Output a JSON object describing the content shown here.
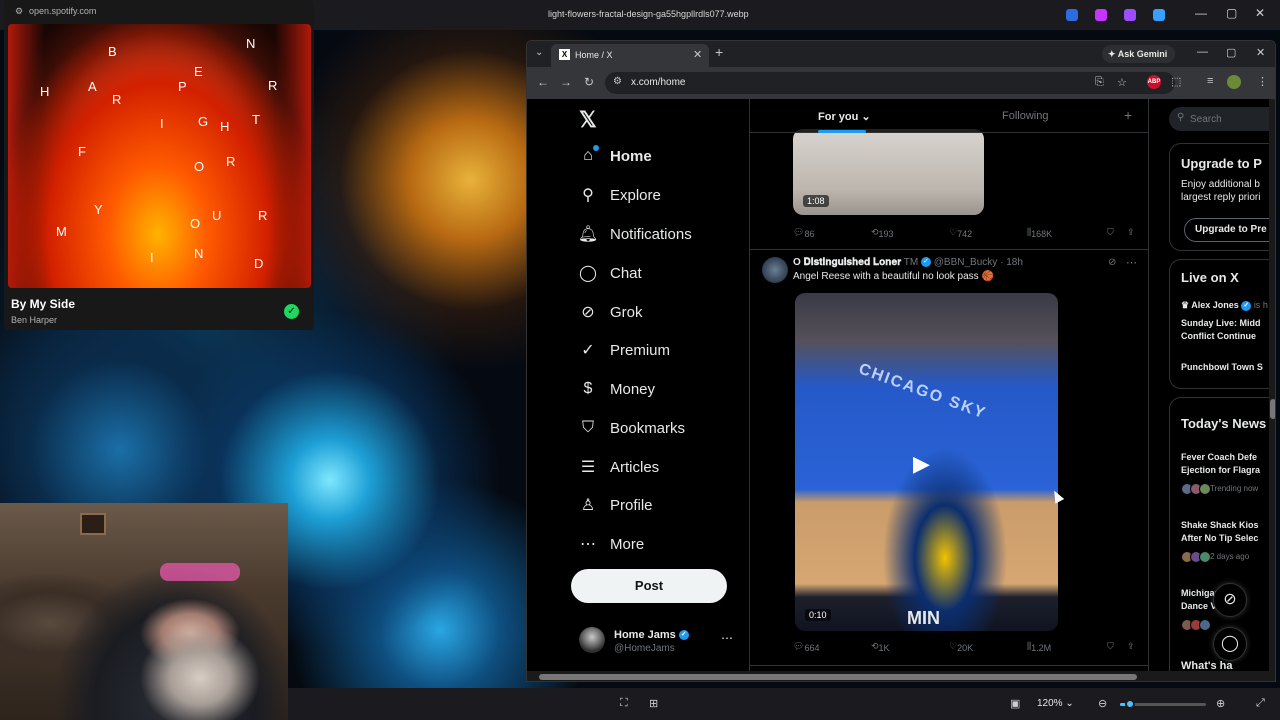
{
  "window": {
    "title": "light-flowers-fractal-design-ga55hgpllrdls077.webp",
    "minimize_icon": "minimize-icon",
    "maximize_icon": "maximize-icon",
    "close_icon": "close-icon"
  },
  "spotify": {
    "url": "open.spotify.com",
    "cover_letters": [
      "B",
      "N",
      "E",
      "H",
      "A",
      "R",
      "P",
      "R",
      "I",
      "G",
      "H",
      "T",
      "F",
      "O",
      "R",
      "Y",
      "O",
      "U",
      "R",
      "M",
      "I",
      "N",
      "D"
    ],
    "track_title": "By My Side",
    "artist": "Ben Harper",
    "saved_icon": "check-icon"
  },
  "browser": {
    "tab_title": "Home / X",
    "ask_gemini": "Ask Gemini",
    "address": "x.com/home"
  },
  "x": {
    "logo": "𝕏",
    "nav": [
      {
        "label": "Home",
        "icon": "home-icon",
        "glyph": "⌂"
      },
      {
        "label": "Explore",
        "icon": "search-icon",
        "glyph": "⚲"
      },
      {
        "label": "Notifications",
        "icon": "bell-icon",
        "glyph": "♫"
      },
      {
        "label": "Chat",
        "icon": "chat-icon",
        "glyph": "◯"
      },
      {
        "label": "Grok",
        "icon": "grok-icon",
        "glyph": "⊘"
      },
      {
        "label": "Premium",
        "icon": "premium-icon",
        "glyph": "✓"
      },
      {
        "label": "Money",
        "icon": "money-icon",
        "glyph": "$"
      },
      {
        "label": "Bookmarks",
        "icon": "bookmark-icon",
        "glyph": "⛉"
      },
      {
        "label": "Articles",
        "icon": "articles-icon",
        "glyph": "☰"
      },
      {
        "label": "Profile",
        "icon": "profile-icon",
        "glyph": "♙"
      },
      {
        "label": "More",
        "icon": "more-icon",
        "glyph": "⋯"
      }
    ],
    "post_button": "Post",
    "account": {
      "name": "Home Jams",
      "handle": "@HomeJams"
    },
    "tabs": {
      "for_you": "For you",
      "following": "Following"
    },
    "post1": {
      "duration": "1:08",
      "replies": "86",
      "reposts": "193",
      "likes": "742",
      "views": "168K"
    },
    "post2": {
      "author": "O 𝐃𝐢𝐬𝐭𝐢𝐧𝐠𝐮𝐢𝐬𝐡𝐞𝐝 𝐋𝐨𝐧𝐞𝐫",
      "tm": "TM",
      "handle": "@BBN_Bucky",
      "time": "18h",
      "text": "Angel Reese with a beautiful no look pass 🏀",
      "duration": "0:10",
      "court_text": "CHICAGO SKY",
      "scoreboard_text": "MIN",
      "replies": "664",
      "reposts": "1K",
      "likes": "20K",
      "views": "1.2M"
    },
    "sidebar": {
      "search_placeholder": "Search",
      "upgrade": {
        "heading": "Upgrade to P",
        "line1": "Enjoy additional b",
        "line2": "largest reply priori",
        "button": "Upgrade to Pre"
      },
      "live": {
        "heading": "Live on X",
        "host": "Alex Jones",
        "host_meta": "is h",
        "title1": "Sunday Live: Midd",
        "title2": "Conflict Continue",
        "title3": "Punchbowl Town S"
      },
      "news": {
        "heading": "Today's News",
        "items": [
          {
            "line1": "Fever Coach Defe",
            "line2": "Ejection for Flagra",
            "meta": "Trending now"
          },
          {
            "line1": "Shake Shack Kios",
            "line2": "After No Tip Selec",
            "meta": "2 days ago"
          },
          {
            "line1": "Michigan",
            "line2": "Dance V",
            "meta": ""
          }
        ]
      },
      "next_heading": "What's ha"
    }
  },
  "viewer": {
    "zoom": "120%",
    "zoom_fraction": 0.12
  },
  "colors": {
    "x_blue": "#1d9bf0",
    "spotify_green": "#1ed760",
    "x_text": "#e7e9ea",
    "x_muted": "#71767b"
  }
}
